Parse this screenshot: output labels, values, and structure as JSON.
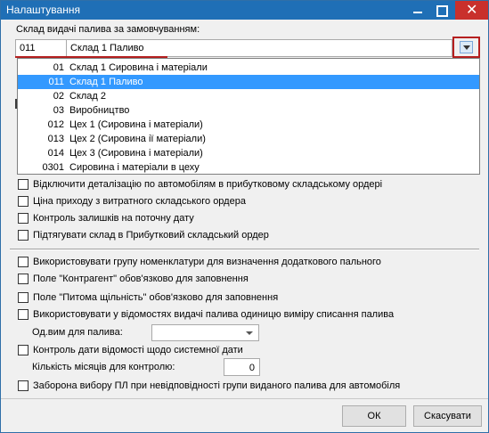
{
  "window": {
    "title": "Налаштування"
  },
  "warehouse_selector": {
    "label": "Склад видачі палива за замовчуванням:",
    "code": "011",
    "name": "Склад 1 Паливо"
  },
  "dropdown_options": [
    {
      "code": "01",
      "name": "Склад 1 Сировина і матеріали",
      "selected": false
    },
    {
      "code": "011",
      "name": "Склад 1 Паливо",
      "selected": true
    },
    {
      "code": "02",
      "name": "Склад 2",
      "selected": false
    },
    {
      "code": "03",
      "name": "Виробництво",
      "selected": false
    },
    {
      "code": "012",
      "name": "Цех 1 (Сировина і матеріали)",
      "selected": false
    },
    {
      "code": "013",
      "name": "Цех 2 (Сировина ії  матеріали)",
      "selected": false
    },
    {
      "code": "014",
      "name": "Цех 3 (Сировина і матеріали)",
      "selected": false
    },
    {
      "code": "0301",
      "name": "Сировина і матеріали в цеху",
      "selected": false
    }
  ],
  "options_group1": [
    "Відключити деталізацію по автомобілям в прибутковому складському ордері",
    "Ціна приходу з витратного складського ордера",
    "Контроль залишків на поточну дату",
    "Підтягувати склад в Прибутковий складський ордер"
  ],
  "options_group2": [
    "Використовувати групу номенклатури для визначення додаткового пального",
    "Поле \"Контрагент\" обов'язково для заповнення",
    "Поле \"Питома щільність\" обов'язково для заповнення",
    "Використовувати у відомостях видачі палива одиницю виміру списання палива"
  ],
  "fuel_unit": {
    "label": "Од.вим для палива:",
    "value": ""
  },
  "date_control": {
    "label": "Контроль дати відомості щодо системної дати"
  },
  "months": {
    "label": "Кількість місяців для контролю:",
    "value": "0"
  },
  "last_option": "Заборона вибору ПЛ при невідповідності групи виданого палива для автомобіля",
  "buttons": {
    "ok": "ОК",
    "cancel": "Скасувати"
  }
}
